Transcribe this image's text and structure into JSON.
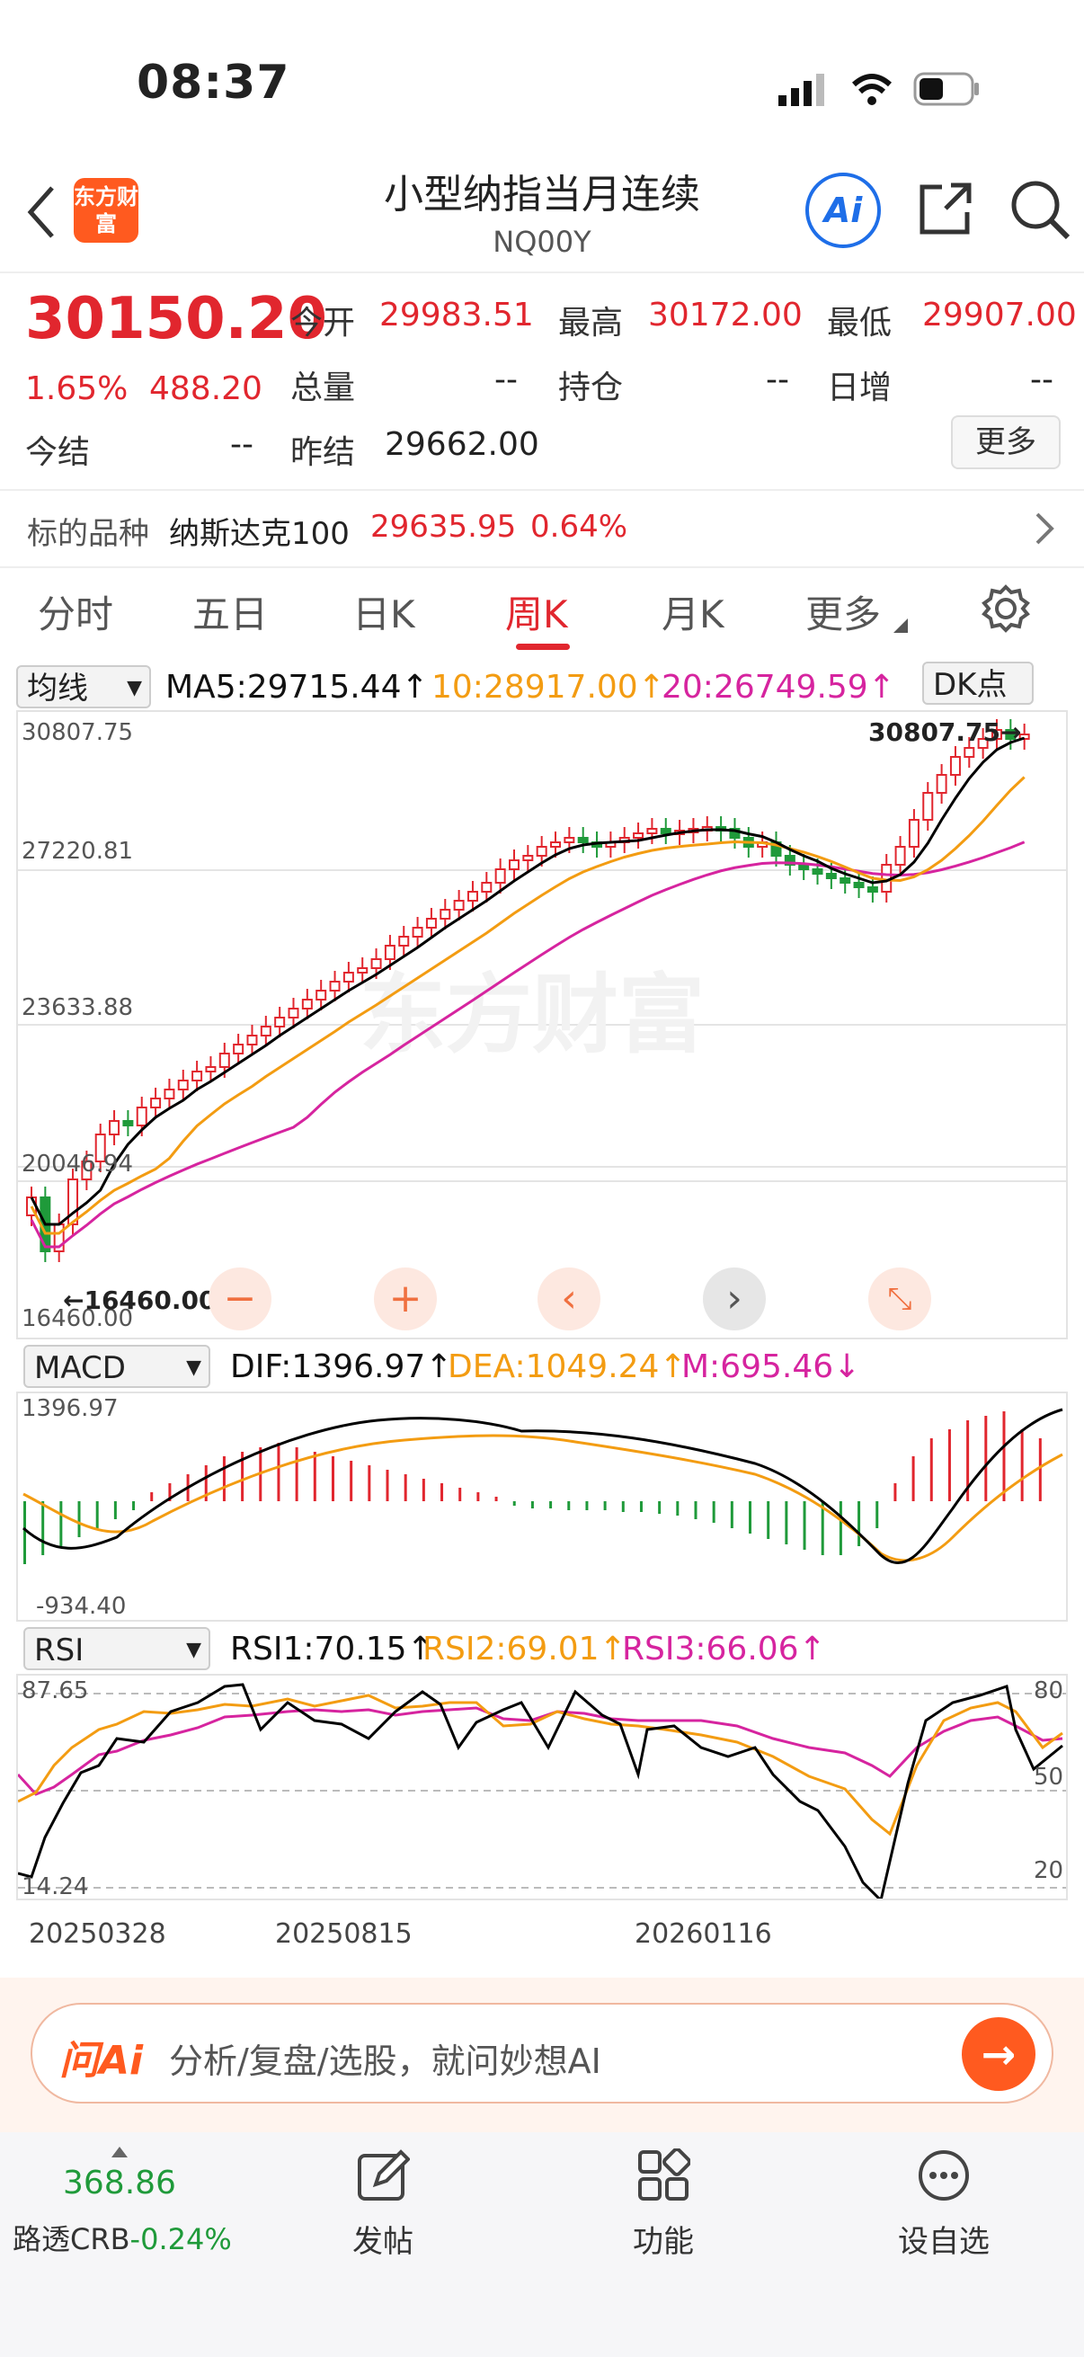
{
  "status": {
    "time": "08:37"
  },
  "header": {
    "logo_text": "东方财富",
    "title": "小型纳指当月连续",
    "code": "NQ00Y",
    "ai_label": "Ai"
  },
  "quote": {
    "price": "30150.20",
    "change_pct": "1.65%",
    "change": "488.20",
    "open_label": "今开",
    "open": "29983.51",
    "high_label": "最高",
    "high": "30172.00",
    "low_label": "最低",
    "low": "29907.00",
    "volume_label": "总量",
    "volume": "--",
    "oi_label": "持仓",
    "oi": "--",
    "daily_inc_label": "日增",
    "daily_inc": "--",
    "settle_label": "今结",
    "settle": "--",
    "prev_settle_label": "昨结",
    "prev_settle": "29662.00",
    "more_label": "更多"
  },
  "underlying": {
    "label": "标的品种",
    "name": "纳斯达克100",
    "price": "29635.95",
    "pct": "0.64%"
  },
  "tabs": [
    "分时",
    "五日",
    "日K",
    "周K",
    "月K",
    "更多"
  ],
  "active_tab": "周K",
  "ma_bar": {
    "selector": "均线",
    "ma5": "MA5:29715.44↑",
    "ma10": "10:28917.00↑",
    "ma20": "20:26749.59↑",
    "dk": "DK点"
  },
  "price_axis": {
    "top": "30807.75",
    "t2": "27220.81",
    "t3": "23633.88",
    "t4": "20046.94",
    "bottom": "16460.00",
    "max_marker": "30807.75→",
    "min_marker": "←16460.00"
  },
  "macd_bar": {
    "selector": "MACD",
    "dif": "DIF:1396.97↑",
    "dea": "DEA:1049.24↑",
    "m": "M:695.46↓",
    "top": "1396.97",
    "bottom": "-934.40"
  },
  "rsi_bar": {
    "selector": "RSI",
    "rsi1": "RSI1:70.15↑",
    "rsi2": "RSI2:69.01↑",
    "rsi3": "RSI3:66.06↑",
    "top": "87.65",
    "bottom": "14.24",
    "r80": "80",
    "r50": "50",
    "r20": "20"
  },
  "dates": [
    "20250328",
    "20250815",
    "20260116"
  ],
  "watermark": "东方财富",
  "ask": {
    "brand": "问Ai",
    "placeholder": "分析/复盘/选股，就问妙想AI"
  },
  "bottom_nav": {
    "crb_value": "368.86",
    "crb_label": "路透CRB",
    "crb_pct": "-0.24%",
    "post": "发帖",
    "func": "功能",
    "watch": "设自选"
  },
  "colors": {
    "up": "#e1262e",
    "down": "#1f9a3a",
    "ma5": "#000000",
    "ma10": "#f39c12",
    "ma20": "#d6249f",
    "accent": "#ff5a1f"
  }
}
